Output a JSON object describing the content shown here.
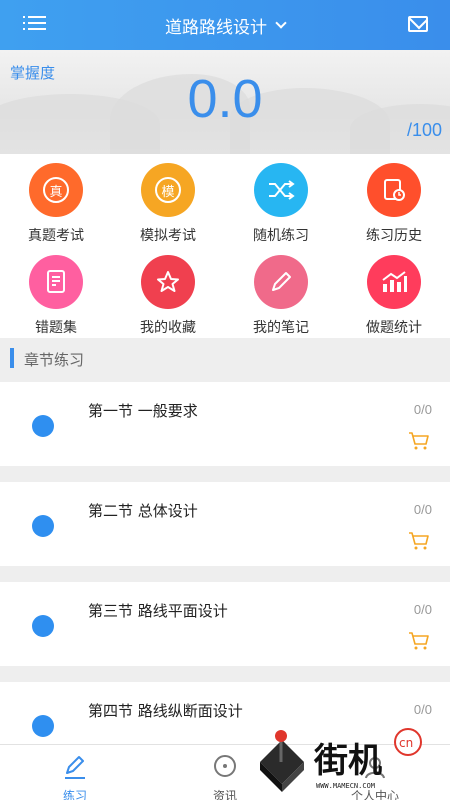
{
  "header": {
    "title": "道路路线设计",
    "menu_icon": "list-icon",
    "mail_icon": "mail-icon"
  },
  "hero": {
    "label": "掌握度",
    "score": "0.0",
    "total": "/100"
  },
  "features": [
    {
      "label": "真题考试",
      "glyph": "真",
      "color": "#ff6a2b",
      "icon": "exam-icon"
    },
    {
      "label": "模拟考试",
      "glyph": "模",
      "color": "#f6a623",
      "icon": "mock-exam-icon"
    },
    {
      "label": "随机练习",
      "glyph": "",
      "color": "#27b6f2",
      "icon": "shuffle-icon"
    },
    {
      "label": "练习历史",
      "glyph": "",
      "color": "#ff4f2c",
      "icon": "history-icon"
    },
    {
      "label": "错题集",
      "glyph": "",
      "color": "#ff5fa0",
      "icon": "wrong-questions-icon"
    },
    {
      "label": "我的收藏",
      "glyph": "",
      "color": "#f0404f",
      "icon": "star-icon"
    },
    {
      "label": "我的笔记",
      "glyph": "",
      "color": "#f06a8a",
      "icon": "pencil-icon"
    },
    {
      "label": "做题统计",
      "glyph": "",
      "color": "#ff3c5c",
      "icon": "stats-icon"
    }
  ],
  "section": {
    "title": "章节练习"
  },
  "chapters": [
    {
      "name": "第一节 一般要求",
      "count": "0/0"
    },
    {
      "name": "第二节 总体设计",
      "count": "0/0"
    },
    {
      "name": "第三节 路线平面设计",
      "count": "0/0"
    },
    {
      "name": "第四节 路线纵断面设计",
      "count": "0/0"
    }
  ],
  "tabs": [
    {
      "label": "练习",
      "active": true,
      "icon": "pencil-icon"
    },
    {
      "label": "资讯",
      "active": false,
      "icon": "news-icon"
    },
    {
      "label": "个人中心",
      "active": false,
      "icon": "user-icon"
    }
  ],
  "watermark": {
    "text": "街机",
    "badge": "cn",
    "url": "WWW.MAMECN.COM"
  },
  "colors": {
    "primary": "#3a8eeb",
    "cart": "#f5a623"
  }
}
